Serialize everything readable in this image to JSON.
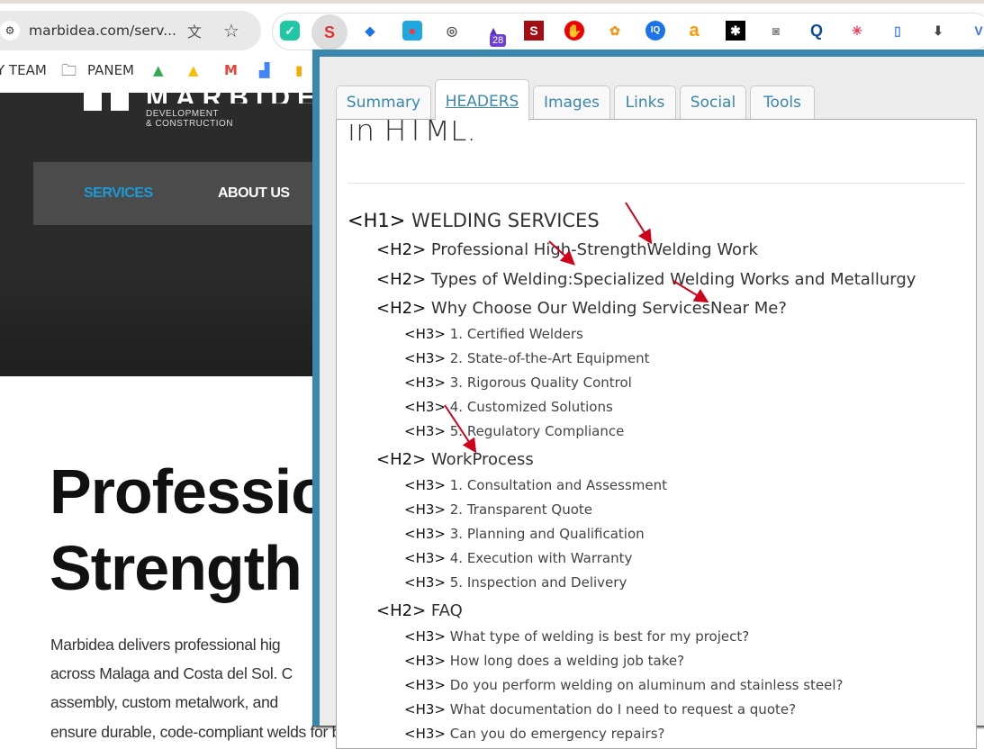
{
  "browser": {
    "url": "marbidea.com/serv...",
    "extension_badge": "28",
    "bookmarks": [
      "Y TEAM",
      "PANEM"
    ]
  },
  "site": {
    "logo_sub1": "DEVELOPMENT",
    "logo_sub2": "& CONSTRUCTION",
    "logo_text": "MARBIDEA",
    "nav": [
      "SERVICES",
      "ABOUT US"
    ],
    "nav_active_color": "#1a9ad6",
    "hero_line1": "Professio",
    "hero_line2": "Strength",
    "paragraph": [
      "Marbidea delivers professional hig",
      "across Malaga and Costa del Sol. C",
      "assembly, custom metalwork, and",
      "ensure durable, code-compliant welds for buildings, infrastructure, renovations, and specialized installations. We"
    ]
  },
  "popup": {
    "tabs": [
      "Summary",
      "HEADERS",
      "Images",
      "Links",
      "Social",
      "Tools"
    ],
    "active_tab": "HEADERS",
    "intro": "in HTML.",
    "headers": [
      {
        "tag": "<H1>",
        "text": "WELDING SERVICES",
        "level": 1
      },
      {
        "tag": "<H2>",
        "text": "Professional High-StrengthWelding Work",
        "level": 2
      },
      {
        "tag": "<H2>",
        "text": "Types of Welding:Specialized Welding Works and Metallurgy",
        "level": 2
      },
      {
        "tag": "<H2>",
        "text": "Why Choose Our Welding ServicesNear Me?",
        "level": 2
      },
      {
        "tag": "<H3>",
        "text": "1. Certified Welders",
        "level": 3
      },
      {
        "tag": "<H3>",
        "text": "2. State-of-the-Art Equipment",
        "level": 3
      },
      {
        "tag": "<H3>",
        "text": "3. Rigorous Quality Control",
        "level": 3
      },
      {
        "tag": "<H3>",
        "text": "4. Customized Solutions",
        "level": 3
      },
      {
        "tag": "<H3>",
        "text": "5. Regulatory Compliance",
        "level": 3
      },
      {
        "tag": "<H2>",
        "text": "WorkProcess",
        "level": 2
      },
      {
        "tag": "<H3>",
        "text": "1. Consultation and Assessment",
        "level": 3
      },
      {
        "tag": "<H3>",
        "text": "2. Transparent Quote",
        "level": 3
      },
      {
        "tag": "<H3>",
        "text": "3. Planning and Qualification",
        "level": 3
      },
      {
        "tag": "<H3>",
        "text": "4. Execution with Warranty",
        "level": 3
      },
      {
        "tag": "<H3>",
        "text": "5. Inspection and Delivery",
        "level": 3
      },
      {
        "tag": "<H2>",
        "text": "FAQ",
        "level": 2
      },
      {
        "tag": "<H3>",
        "text": "What type of welding is best for my project?",
        "level": 3
      },
      {
        "tag": "<H3>",
        "text": "How long does a welding job take?",
        "level": 3
      },
      {
        "tag": "<H3>",
        "text": "Do you perform welding on aluminum and stainless steel?",
        "level": 3
      },
      {
        "tag": "<H3>",
        "text": "What documentation do I need to request a quote?",
        "level": 3
      },
      {
        "tag": "<H3>",
        "text": "Can you do emergency repairs?",
        "level": 3
      }
    ]
  },
  "colors": {
    "popup_border": "#3a87ad",
    "annotation_arrow": "#d0021b"
  }
}
